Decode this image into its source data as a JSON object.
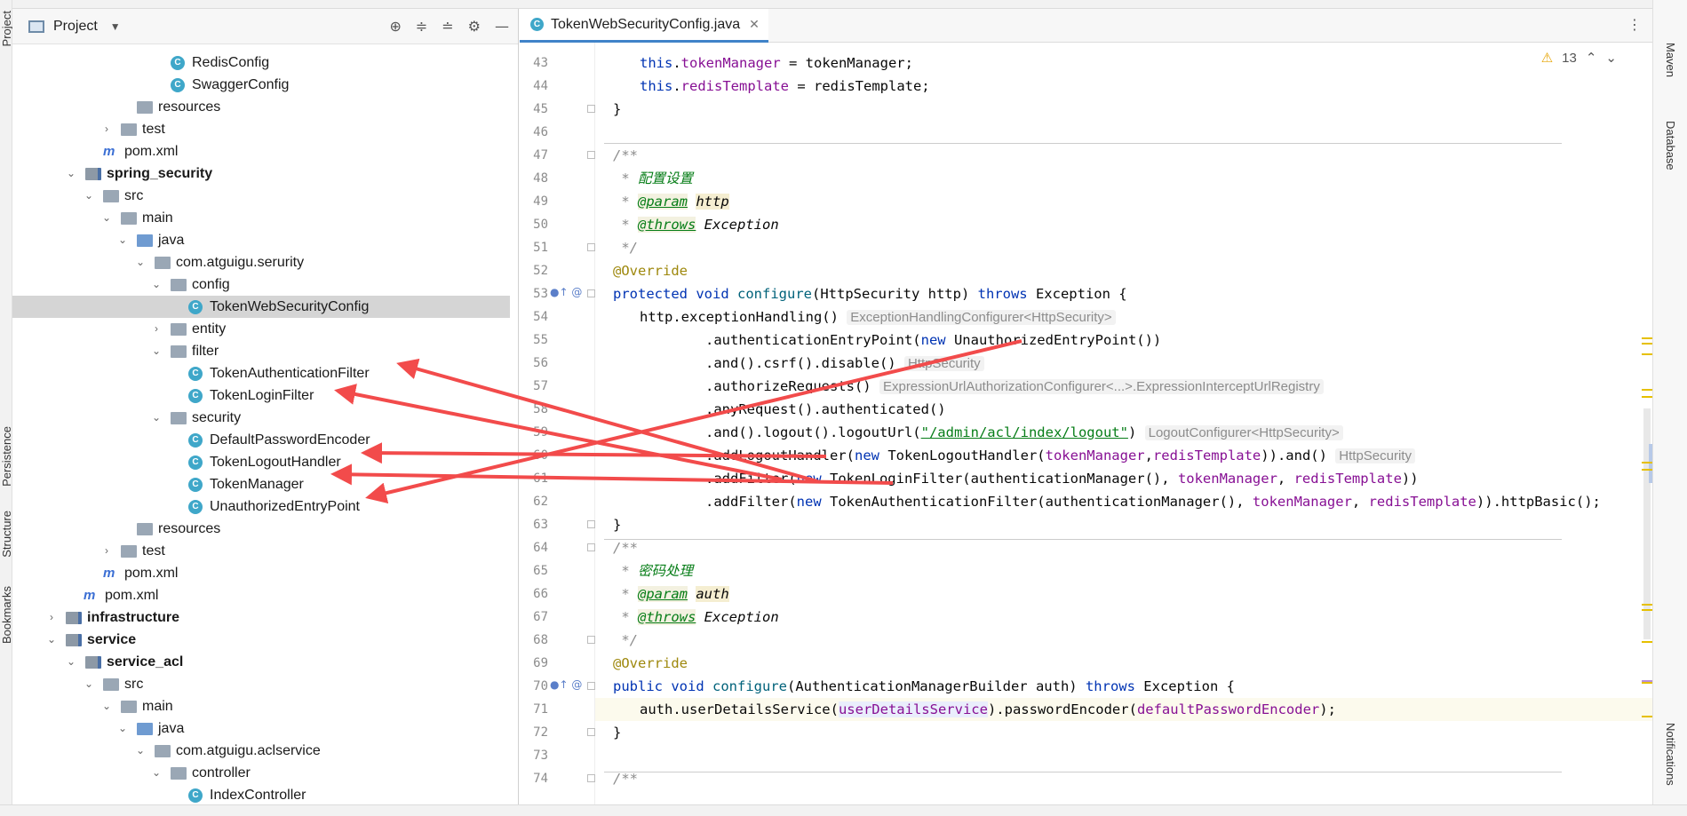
{
  "left_strip": {
    "project": "Project",
    "persistence": "Persistence",
    "structure": "Structure",
    "bookmarks": "Bookmarks"
  },
  "right_strip": {
    "maven": "Maven",
    "database": "Database",
    "notifications": "Notifications"
  },
  "project_panel": {
    "title": "Project"
  },
  "tree": [
    {
      "label": "RedisConfig",
      "icon": "class",
      "indent": 178,
      "arrow": "",
      "bold": false
    },
    {
      "label": "SwaggerConfig",
      "icon": "class",
      "indent": 178,
      "arrow": "",
      "bold": false
    },
    {
      "label": "resources",
      "icon": "folder",
      "indent": 140,
      "arrow": "",
      "bold": false
    },
    {
      "label": "test",
      "icon": "folder",
      "indent": 122,
      "arrow": "›",
      "bold": false
    },
    {
      "label": "pom.xml",
      "icon": "maven",
      "indent": 102,
      "arrow": "",
      "bold": false
    },
    {
      "label": "spring_security",
      "icon": "module",
      "indent": 82,
      "arrow": "⌄",
      "bold": true
    },
    {
      "label": "src",
      "icon": "folder",
      "indent": 102,
      "arrow": "⌄",
      "bold": false
    },
    {
      "label": "main",
      "icon": "folder",
      "indent": 122,
      "arrow": "⌄",
      "bold": false
    },
    {
      "label": "java",
      "icon": "folder-blue",
      "indent": 140,
      "arrow": "⌄",
      "bold": false
    },
    {
      "label": "com.atguigu.serurity",
      "icon": "package",
      "indent": 160,
      "arrow": "⌄",
      "bold": false
    },
    {
      "label": "config",
      "icon": "package",
      "indent": 178,
      "arrow": "⌄",
      "bold": false
    },
    {
      "label": "TokenWebSecurityConfig",
      "icon": "class",
      "indent": 198,
      "arrow": "",
      "bold": false,
      "selected": true
    },
    {
      "label": "entity",
      "icon": "package",
      "indent": 178,
      "arrow": "›",
      "bold": false
    },
    {
      "label": "filter",
      "icon": "package",
      "indent": 178,
      "arrow": "⌄",
      "bold": false
    },
    {
      "label": "TokenAuthenticationFilter",
      "icon": "class",
      "indent": 198,
      "arrow": "",
      "bold": false
    },
    {
      "label": "TokenLoginFilter",
      "icon": "class",
      "indent": 198,
      "arrow": "",
      "bold": false
    },
    {
      "label": "security",
      "icon": "package",
      "indent": 178,
      "arrow": "⌄",
      "bold": false
    },
    {
      "label": "DefaultPasswordEncoder",
      "icon": "class",
      "indent": 198,
      "arrow": "",
      "bold": false
    },
    {
      "label": "TokenLogoutHandler",
      "icon": "class",
      "indent": 198,
      "arrow": "",
      "bold": false
    },
    {
      "label": "TokenManager",
      "icon": "class",
      "indent": 198,
      "arrow": "",
      "bold": false
    },
    {
      "label": "UnauthorizedEntryPoint",
      "icon": "class",
      "indent": 198,
      "arrow": "",
      "bold": false
    },
    {
      "label": "resources",
      "icon": "folder",
      "indent": 140,
      "arrow": "",
      "bold": false
    },
    {
      "label": "test",
      "icon": "folder",
      "indent": 122,
      "arrow": "›",
      "bold": false
    },
    {
      "label": "pom.xml",
      "icon": "maven",
      "indent": 102,
      "arrow": "",
      "bold": false
    },
    {
      "label": "pom.xml",
      "icon": "maven",
      "indent": 80,
      "arrow": "",
      "bold": false
    },
    {
      "label": "infrastructure",
      "icon": "module",
      "indent": 60,
      "arrow": "›",
      "bold": true
    },
    {
      "label": "service",
      "icon": "module",
      "indent": 60,
      "arrow": "⌄",
      "bold": true
    },
    {
      "label": "service_acl",
      "icon": "module",
      "indent": 82,
      "arrow": "⌄",
      "bold": true
    },
    {
      "label": "src",
      "icon": "folder",
      "indent": 102,
      "arrow": "⌄",
      "bold": false
    },
    {
      "label": "main",
      "icon": "folder",
      "indent": 122,
      "arrow": "⌄",
      "bold": false
    },
    {
      "label": "java",
      "icon": "folder-blue",
      "indent": 140,
      "arrow": "⌄",
      "bold": false
    },
    {
      "label": "com.atguigu.aclservice",
      "icon": "package",
      "indent": 160,
      "arrow": "⌄",
      "bold": false
    },
    {
      "label": "controller",
      "icon": "package",
      "indent": 178,
      "arrow": "⌄",
      "bold": false
    },
    {
      "label": "IndexController",
      "icon": "class",
      "indent": 198,
      "arrow": "",
      "bold": false
    }
  ],
  "editor": {
    "tab_label": "TokenWebSecurityConfig.java",
    "warnings_count": "13",
    "line_numbers": [
      "43",
      "44",
      "45",
      "46",
      "47",
      "48",
      "49",
      "50",
      "51",
      "52",
      "53",
      "54",
      "55",
      "56",
      "57",
      "58",
      "59",
      "60",
      "61",
      "62",
      "63",
      "64",
      "65",
      "66",
      "67",
      "68",
      "69",
      "70",
      "71",
      "72",
      "73",
      "74"
    ],
    "hints": {
      "h54": "ExceptionHandlingConfigurer<HttpSecurity>",
      "h56": "HttpSecurity",
      "h57": "ExpressionUrlAuthorizationConfigurer<...>.ExpressionInterceptUrlRegistry",
      "h59": "LogoutConfigurer<HttpSecurity>",
      "h60": "HttpSecurity"
    },
    "comments": {
      "c48": "配置设置",
      "c65": "密码处理"
    },
    "logout_url": "\"/admin/acl/index/logout\""
  },
  "colors": {
    "accent": "#4083c9",
    "arrow": "#f24b4b",
    "keyword": "#0033b3",
    "field": "#871094"
  },
  "icons": [
    "project-icon",
    "locate-icon",
    "expand-all-icon",
    "collapse-all-icon",
    "gear-icon",
    "minimize-icon",
    "warning-icon",
    "chevron-up-icon",
    "chevron-down-icon",
    "kebab-menu-icon",
    "class-icon",
    "folder-icon",
    "maven-icon"
  ]
}
